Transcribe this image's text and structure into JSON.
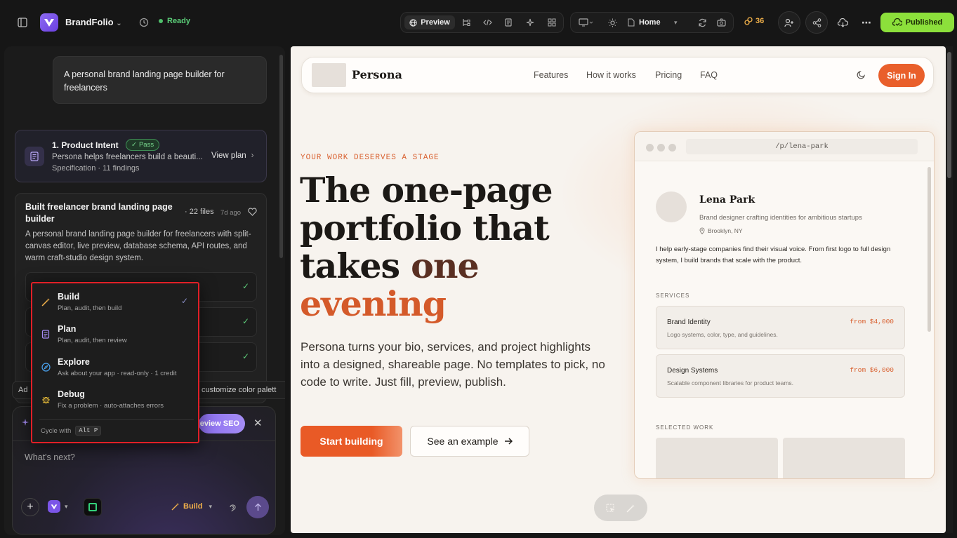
{
  "app": {
    "name": "BrandFolio",
    "status": "Ready"
  },
  "toolbar": {
    "preview_label": "Preview",
    "page_selector": "Home",
    "credits": "36",
    "published_label": "Published"
  },
  "chat": {
    "user_message": "A personal brand landing page builder for freelancers",
    "intent_card": {
      "title": "1. Product Intent",
      "badge": "Pass",
      "description": "Persona helps freelancers build a beauti...",
      "meta": "Specification · 11 findings",
      "action": "View plan"
    },
    "built_card": {
      "title": "Built freelancer brand landing page builder",
      "files": "· 22 files",
      "age": "7d ago",
      "description": "A personal brand landing page builder for freelancers with split-canvas editor, live preview, database schema, API routes, and warm craft-studio design system."
    },
    "suggestion_chips": [
      "Ad",
      "customize color palett"
    ],
    "composer": {
      "placeholder": "What's next?",
      "review_seo_label": "eview SEO",
      "mode_label": "Build"
    }
  },
  "mode_menu": {
    "items": [
      {
        "title": "Build",
        "desc": "Plan, audit, then build",
        "selected": true
      },
      {
        "title": "Plan",
        "desc": "Plan, audit, then review",
        "selected": false
      },
      {
        "title": "Explore",
        "desc": "Ask about your app · read-only · 1 credit",
        "selected": false
      },
      {
        "title": "Debug",
        "desc": "Fix a problem · auto-attaches errors",
        "selected": false
      }
    ],
    "cycle_label": "Cycle with",
    "cycle_key": "Alt P"
  },
  "site": {
    "brand": "Persona",
    "nav_links": [
      "Features",
      "How it works",
      "Pricing",
      "FAQ"
    ],
    "signin_label": "Sign In",
    "eyebrow": "YOUR WORK DESERVES A STAGE",
    "headline": {
      "line1": "The one-page",
      "line2": "portfolio that",
      "line3_a": "takes ",
      "line3_b": "one",
      "line4": "evening"
    },
    "subhead": "Persona turns your bio, services, and project highlights into a designed, shareable page. No templates to pick, no code to write. Just fill, preview, publish.",
    "cta_primary": "Start building",
    "cta_secondary": "See an example"
  },
  "mock": {
    "url": "/p/lena-park",
    "name": "Lena Park",
    "tagline": "Brand designer crafting identities for ambitious startups",
    "location": "Brooklyn, NY",
    "bio": "I help early-stage companies find their visual voice. From first logo to full design system, I build brands that scale with the product.",
    "services_label": "SERVICES",
    "services": [
      {
        "name": "Brand Identity",
        "price": "from $4,000",
        "desc": "Logo systems, color, type, and guidelines."
      },
      {
        "name": "Design Systems",
        "price": "from $6,000",
        "desc": "Scalable component libraries for product teams."
      }
    ],
    "work_label": "SELECTED WORK"
  },
  "colors": {
    "accent": "#e95f2b",
    "published": "#8ce03b",
    "highlight_border": "#e01f27",
    "ready": "#5cd17a"
  }
}
